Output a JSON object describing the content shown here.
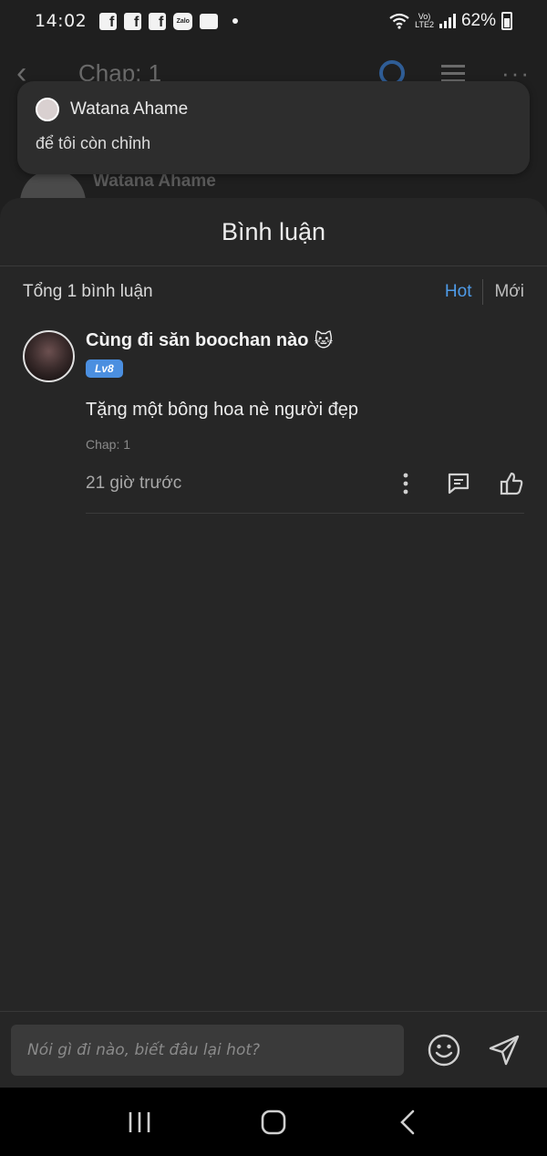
{
  "status_bar": {
    "time": "14:02",
    "network": "LTE2",
    "battery": "62%"
  },
  "background_header": {
    "title": "Chap: 1",
    "user_name": "Watana Ahame"
  },
  "notification": {
    "sender": "Watana Ahame",
    "message": "để tôi còn chỉnh"
  },
  "comments_sheet": {
    "title": "Bình luận",
    "total_label": "Tổng 1 bình luận",
    "sort_hot": "Hot",
    "sort_new": "Mới"
  },
  "comments": [
    {
      "user_name": "Cùng đi săn boochan nào",
      "emoji": "🐱",
      "level_badge": "Lv8",
      "text": "Tặng một bông hoa nè người đẹp",
      "chapter": "Chap: 1",
      "time": "21 giờ trước"
    }
  ],
  "input_bar": {
    "placeholder": "Nói gì đi nào, biết đâu lại hot?"
  },
  "colors": {
    "accent": "#4e9be8",
    "badge": "#4b8fe0",
    "background": "#1f1f1f",
    "sheet": "#262626"
  }
}
